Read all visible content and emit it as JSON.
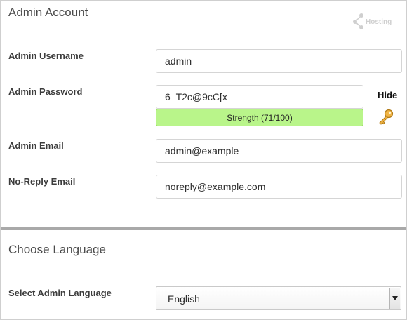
{
  "admin_account": {
    "title": "Admin Account",
    "logo_text": "Hosting",
    "username": {
      "label": "Admin Username",
      "value": "admin"
    },
    "password": {
      "label": "Admin Password",
      "value": "6_T2c@9cC[x",
      "toggle_label": "Hide",
      "strength_text": "Strength (71/100)",
      "strength_score": 71
    },
    "email": {
      "label": "Admin Email",
      "value": "admin@example"
    },
    "noreply": {
      "label": "No-Reply Email",
      "value": "noreply@example.com"
    }
  },
  "language": {
    "title": "Choose Language",
    "select_label": "Select Admin Language",
    "selected": "English"
  },
  "icons": {
    "key": "key-icon",
    "logo": "hosting-logo-icon",
    "dropdown": "chevron-down-icon"
  },
  "colors": {
    "strength_fill": "#b9f58a",
    "strength_border": "#8fd05a",
    "key_gold": "#e0a431",
    "divider": "#a9a9a9"
  }
}
